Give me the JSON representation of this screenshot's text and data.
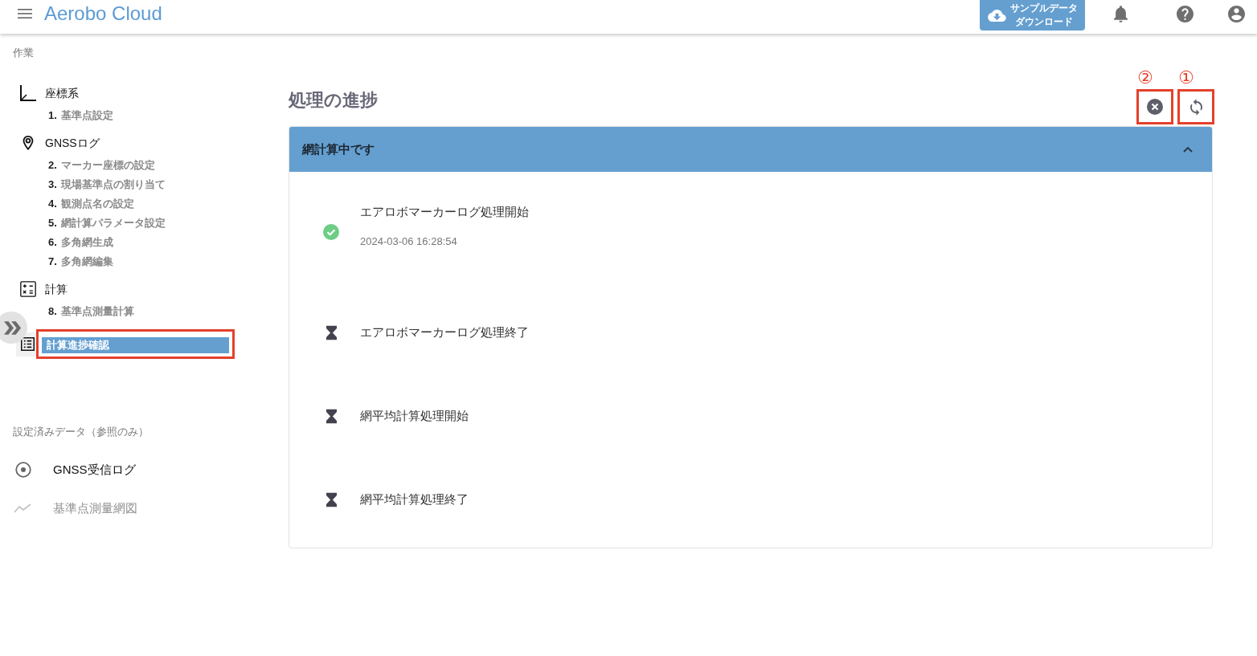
{
  "app_bar": {
    "title": "Aerobo Cloud",
    "download_button": {
      "lines": [
        "サンプルデータ",
        "ダウンロード"
      ]
    }
  },
  "sidebar": {
    "section_label": "作業",
    "groups": [
      {
        "label": "座標系",
        "selected": false,
        "highlighted": false,
        "children": [
          {
            "number": "1.",
            "label": "基準点設定",
            "selected": false
          }
        ]
      },
      {
        "label": "GNSSログ",
        "selected": false,
        "highlighted": false,
        "children": [
          {
            "number": "2.",
            "label": "マーカー座標の設定",
            "selected": false
          },
          {
            "number": "3.",
            "label": "現場基準点の割り当て",
            "selected": false
          },
          {
            "number": "4.",
            "label": "観測点名の設定",
            "selected": false
          },
          {
            "number": "5.",
            "label": "網計算パラメータ設定",
            "selected": false
          },
          {
            "number": "6.",
            "label": "多角網生成",
            "selected": false
          },
          {
            "number": "7.",
            "label": "多角網編集",
            "selected": false
          }
        ]
      },
      {
        "label": "計算",
        "selected": false,
        "highlighted": false,
        "children": [
          {
            "number": "8.",
            "label": "基準点測量計算",
            "selected": false
          }
        ]
      },
      {
        "label": "計算進捗確認",
        "selected": true,
        "highlighted": true
      }
    ],
    "reference_label": "設定済みデータ（参照のみ）",
    "reference_items": [
      {
        "label": "GNSS受信ログ",
        "disabled": false
      },
      {
        "label": "基準点測量網図",
        "disabled": true
      }
    ]
  },
  "main": {
    "title": "処理の進捗",
    "actions": [
      {
        "kind": "cancel",
        "callout": "②",
        "highlighted": true
      },
      {
        "kind": "refresh",
        "callout": "①",
        "highlighted": true
      }
    ],
    "panel": {
      "header": "網計算中です",
      "expanded": true,
      "steps": [
        {
          "label": "エアロボマーカーログ処理開始",
          "done": true,
          "time": "2024-03-06 16:28:54"
        },
        {
          "label": "エアロボマーカーログ処理終了",
          "done": false
        },
        {
          "label": "網平均計算処理開始",
          "done": false
        },
        {
          "label": "網平均計算処理終了",
          "done": false
        }
      ]
    }
  }
}
